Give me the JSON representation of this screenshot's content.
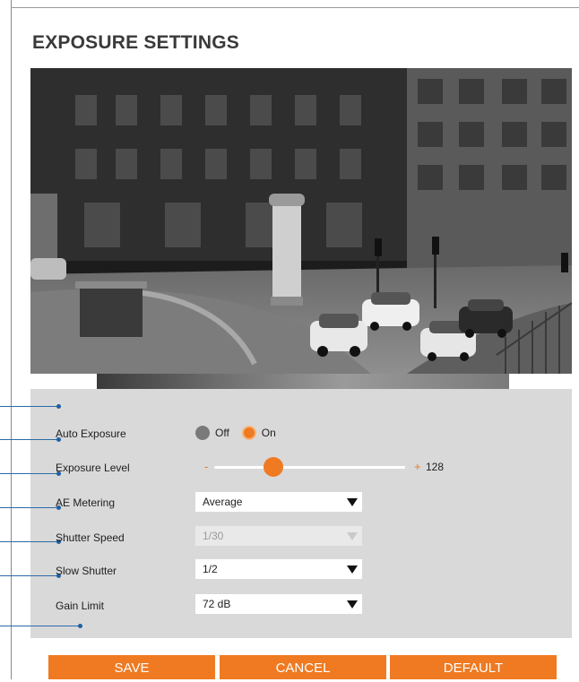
{
  "page": {
    "title": "EXPOSURE SETTINGS"
  },
  "preview": {
    "description_icon": "camera-preview-image"
  },
  "settings": {
    "auto_exposure": {
      "label": "Auto Exposure",
      "options": [
        "Off",
        "On"
      ],
      "selected": "On"
    },
    "exposure_level": {
      "label": "Exposure Level",
      "minus": "-",
      "plus": "+",
      "value": "128",
      "level_fraction": 0.31
    },
    "ae_metering": {
      "label": "AE Metering",
      "value": "Average"
    },
    "shutter_speed": {
      "label": "Shutter Speed",
      "value": "1/30",
      "disabled": true
    },
    "slow_shutter": {
      "label": "Slow Shutter",
      "value": "1/2"
    },
    "gain_limit": {
      "label": "Gain Limit",
      "value": "72 dB"
    }
  },
  "buttons": {
    "save": "SAVE",
    "cancel": "CANCEL",
    "default": "DEFAULT"
  },
  "colors": {
    "accent": "#ef7a21",
    "panel": "#d9d9d9",
    "callout": "#1f5fa0"
  }
}
